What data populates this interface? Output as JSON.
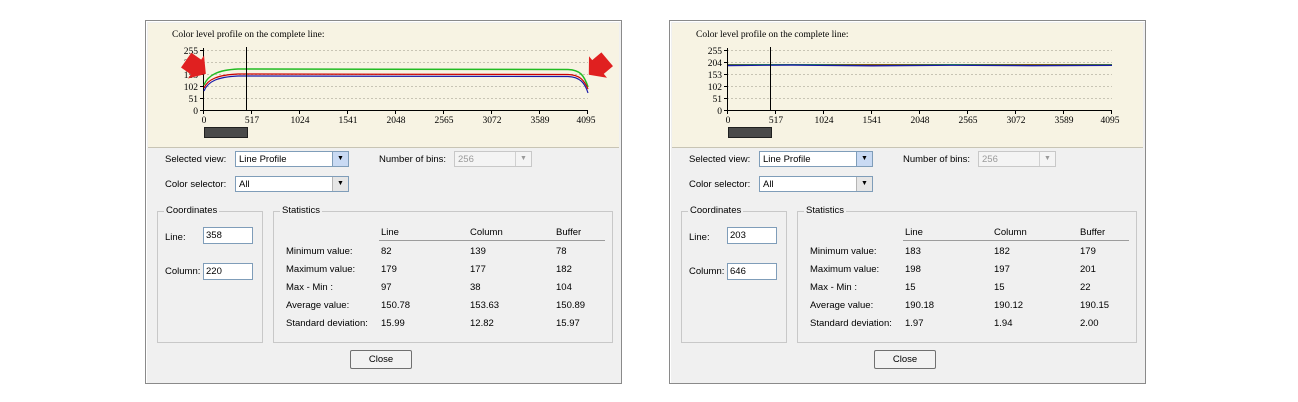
{
  "panels": [
    {
      "plot": {
        "title": "Color level profile on the complete line:",
        "y_ticks": [
          "255",
          "204",
          "153",
          "102",
          "51",
          "0"
        ],
        "x_ticks": [
          "0",
          "517",
          "1024",
          "1541",
          "2048",
          "2565",
          "3072",
          "3589",
          "4095"
        ]
      },
      "selected_view_label": "Selected view:",
      "selected_view_value": "Line Profile",
      "number_of_bins_label": "Number of bins:",
      "number_of_bins_value": "256",
      "color_selector_label": "Color selector:",
      "color_selector_value": "All",
      "coordinates": {
        "title": "Coordinates",
        "line_label": "Line:",
        "line_value": "358",
        "column_label": "Column:",
        "column_value": "220"
      },
      "statistics": {
        "title": "Statistics",
        "headers": [
          "Line",
          "Column",
          "Buffer"
        ],
        "rows": [
          {
            "label": "Minimum value:",
            "values": [
              "82",
              "139",
              "78"
            ]
          },
          {
            "label": "Maximum value:",
            "values": [
              "179",
              "177",
              "182"
            ]
          },
          {
            "label": "Max - Min :",
            "values": [
              "97",
              "38",
              "104"
            ]
          },
          {
            "label": "Average value:",
            "values": [
              "150.78",
              "153.63",
              "150.89"
            ]
          },
          {
            "label": "Standard deviation:",
            "values": [
              "15.99",
              "12.82",
              "15.97"
            ]
          }
        ]
      },
      "close_label": "Close"
    },
    {
      "plot": {
        "title": "Color level profile on the complete line:",
        "y_ticks": [
          "255",
          "204",
          "153",
          "102",
          "51",
          "0"
        ],
        "x_ticks": [
          "0",
          "517",
          "1024",
          "1541",
          "2048",
          "2565",
          "3072",
          "3589",
          "4095"
        ]
      },
      "selected_view_label": "Selected view:",
      "selected_view_value": "Line Profile",
      "number_of_bins_label": "Number of bins:",
      "number_of_bins_value": "256",
      "color_selector_label": "Color selector:",
      "color_selector_value": "All",
      "coordinates": {
        "title": "Coordinates",
        "line_label": "Line:",
        "line_value": "203",
        "column_label": "Column:",
        "column_value": "646"
      },
      "statistics": {
        "title": "Statistics",
        "headers": [
          "Line",
          "Column",
          "Buffer"
        ],
        "rows": [
          {
            "label": "Minimum value:",
            "values": [
              "183",
              "182",
              "179"
            ]
          },
          {
            "label": "Maximum value:",
            "values": [
              "198",
              "197",
              "201"
            ]
          },
          {
            "label": "Max - Min :",
            "values": [
              "15",
              "15",
              "22"
            ]
          },
          {
            "label": "Average value:",
            "values": [
              "190.18",
              "190.12",
              "190.15"
            ]
          },
          {
            "label": "Standard deviation:",
            "values": [
              "1.97",
              "1.94",
              "2.00"
            ]
          }
        ]
      },
      "close_label": "Close"
    }
  ],
  "colors": {
    "plot_background": "#f7f3e3",
    "red_channel": "#cc0000",
    "green_channel": "#22bb22",
    "blue_channel": "#1a1aa8",
    "arrow": "#e02020"
  }
}
